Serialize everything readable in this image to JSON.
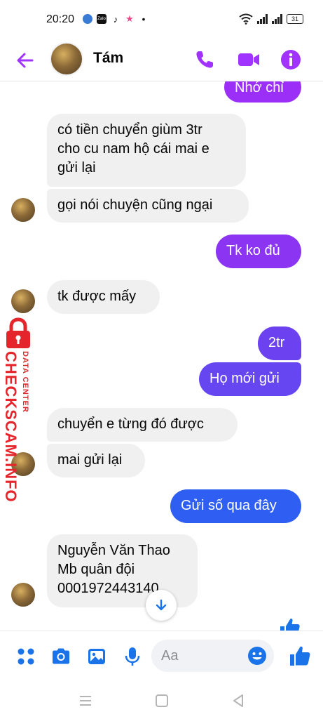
{
  "status_bar": {
    "time": "20:20",
    "app_icons": [
      "app-icon",
      "zalo-icon",
      "tiktok-icon",
      "star-app-icon",
      "notification-dot"
    ],
    "zalo_label": "Zalo",
    "battery": "31"
  },
  "header": {
    "contact_name": "Tám",
    "accent_color": "#a033ff",
    "icons": [
      "back-arrow-icon",
      "phone-icon",
      "video-camera-icon",
      "info-icon"
    ]
  },
  "messages": [
    {
      "direction": "out",
      "lines": [
        "Nhớ chỉ"
      ],
      "color": "#9b2ff7"
    },
    {
      "direction": "in",
      "lines": [
        "có tiền chuyển giùm 3tr",
        "cho cu nam hộ cái mai e",
        "gửi lại"
      ]
    },
    {
      "direction": "in",
      "lines": [
        "gọi nói chuyện cũng ngại"
      ]
    },
    {
      "direction": "out",
      "lines": [
        "Tk ko đủ"
      ],
      "color": "#8b34f2"
    },
    {
      "direction": "in",
      "lines": [
        "tk được mấy"
      ]
    },
    {
      "direction": "out",
      "lines": [
        "2tr"
      ],
      "color": "#6b41f0"
    },
    {
      "direction": "out",
      "lines": [
        "Họ mới gửi"
      ],
      "color": "#6646f0"
    },
    {
      "direction": "in",
      "lines": [
        "chuyển e từng đó được"
      ]
    },
    {
      "direction": "in",
      "lines": [
        "mai gửi lại"
      ]
    },
    {
      "direction": "out",
      "lines": [
        "Gửi số qua đây"
      ],
      "color": "#2f5ff2"
    },
    {
      "direction": "in",
      "lines": [
        "Nguyễn Văn Thao",
        "Mb quân đội",
        "0001972443140"
      ]
    }
  ],
  "watermark": {
    "brand": "CHECKSCAM.INFO",
    "tagline": "DATA CENTER",
    "color": "#e4252b"
  },
  "composer": {
    "placeholder": "Aa",
    "icons": [
      "menu-dots-icon",
      "camera-icon",
      "image-icon",
      "microphone-icon",
      "emoji-icon",
      "thumbs-up-icon"
    ],
    "icon_color": "#1a73e8"
  },
  "navbar": {
    "icons": [
      "menu-icon",
      "home-square-icon",
      "back-triangle-icon"
    ]
  }
}
